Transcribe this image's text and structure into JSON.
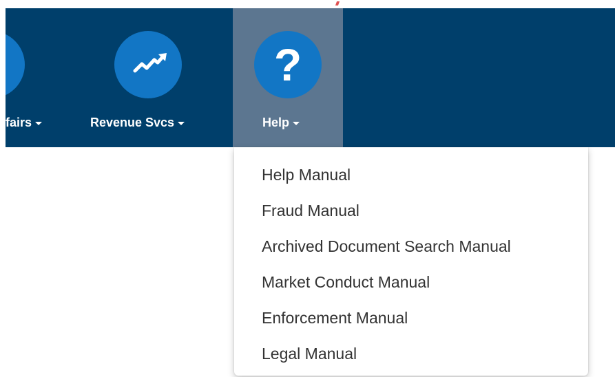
{
  "navbar": {
    "background": "#003f6b",
    "items": [
      {
        "label": "fairs",
        "icon": "circle-icon",
        "active": false
      },
      {
        "label": "Revenue Svcs",
        "icon": "trending-up-icon",
        "active": false
      },
      {
        "label": "Help",
        "icon": "question-mark-icon",
        "active": true
      }
    ],
    "help_icon_glyph": "?"
  },
  "colors": {
    "nav_bg": "#003f6b",
    "active_bg": "#5c7690",
    "icon_circle": "#1276c5",
    "menu_text": "#333333"
  },
  "help_menu": {
    "items": [
      "Help Manual",
      "Fraud Manual",
      "Archived Document Search Manual",
      "Market Conduct Manual",
      "Enforcement Manual",
      "Legal Manual"
    ]
  }
}
